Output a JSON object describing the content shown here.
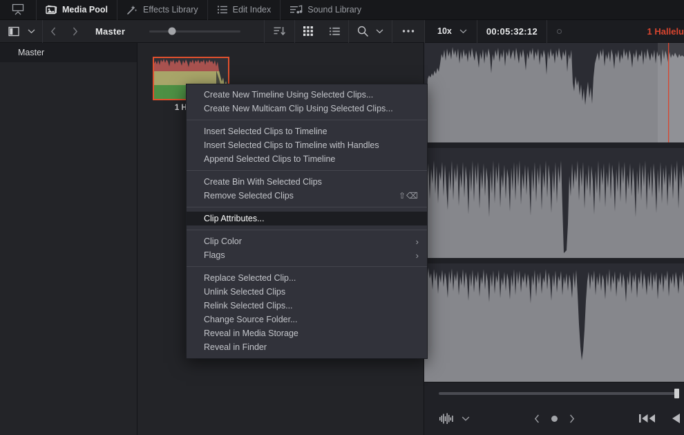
{
  "tabbar": {
    "panel_toggle_icon": "monitor-collapse-icon",
    "tabs": [
      {
        "label": "Media Pool",
        "icon": "media-pool-icon",
        "active": true
      },
      {
        "label": "Effects Library",
        "icon": "effects-wand-icon",
        "active": false
      },
      {
        "label": "Edit Index",
        "icon": "edit-index-list-icon",
        "active": false
      },
      {
        "label": "Sound Library",
        "icon": "sound-library-icon",
        "active": false
      }
    ]
  },
  "toolbar": {
    "sidebar_toggle_icon": "sidebar-panel-icon",
    "sidebar_chevron_icon": "chevron-down-icon",
    "back_icon": "chevron-left-icon",
    "forward_icon": "chevron-right-icon",
    "bin_title": "Master",
    "thumb_size_slider_value": 25,
    "sort_icon": "sort-descending-icon",
    "grid_view_icon": "grid-view-icon",
    "list_view_icon": "list-view-icon",
    "search_icon": "search-icon",
    "search_chevron_icon": "chevron-down-icon",
    "options_icon": "more-options-icon"
  },
  "viewer_toolbar": {
    "zoom_level": "10x",
    "zoom_chevron_icon": "chevron-down-icon",
    "timecode": "00:05:32:12",
    "record_indicator_icon": "record-circle-icon",
    "clip_name": "1 Hallelu"
  },
  "sidebar": {
    "items": [
      {
        "label": "Master",
        "selected": true
      }
    ]
  },
  "media_pool": {
    "clips": [
      {
        "name": "1 Hallelu",
        "selected": true
      }
    ]
  },
  "context_menu": {
    "groups": [
      {
        "items": [
          {
            "label": "Create New Timeline Using Selected Clips...",
            "shortcut": "",
            "submenu": false,
            "highlight": false
          },
          {
            "label": "Create New Multicam Clip Using Selected Clips...",
            "shortcut": "",
            "submenu": false,
            "highlight": false
          }
        ]
      },
      {
        "items": [
          {
            "label": "Insert Selected Clips to Timeline",
            "shortcut": "",
            "submenu": false,
            "highlight": false
          },
          {
            "label": "Insert Selected Clips to Timeline with Handles",
            "shortcut": "",
            "submenu": false,
            "highlight": false
          },
          {
            "label": "Append Selected Clips to Timeline",
            "shortcut": "",
            "submenu": false,
            "highlight": false
          }
        ]
      },
      {
        "items": [
          {
            "label": "Create Bin With Selected Clips",
            "shortcut": "",
            "submenu": false,
            "highlight": false
          },
          {
            "label": "Remove Selected Clips",
            "shortcut": "⇧⌫",
            "submenu": false,
            "highlight": false
          }
        ]
      },
      {
        "items": [
          {
            "label": "Clip Attributes...",
            "shortcut": "",
            "submenu": false,
            "highlight": true
          }
        ]
      },
      {
        "items": [
          {
            "label": "Clip Color",
            "shortcut": "",
            "submenu": true,
            "highlight": false
          },
          {
            "label": "Flags",
            "shortcut": "",
            "submenu": true,
            "highlight": false
          }
        ]
      },
      {
        "items": [
          {
            "label": "Replace Selected Clip...",
            "shortcut": "",
            "submenu": false,
            "highlight": false
          },
          {
            "label": "Unlink Selected Clips",
            "shortcut": "",
            "submenu": false,
            "highlight": false
          },
          {
            "label": "Relink Selected Clips...",
            "shortcut": "",
            "submenu": false,
            "highlight": false
          },
          {
            "label": "Change Source Folder...",
            "shortcut": "",
            "submenu": false,
            "highlight": false
          },
          {
            "label": "Reveal in Media Storage",
            "shortcut": "",
            "submenu": false,
            "highlight": false
          },
          {
            "label": "Reveal in Finder",
            "shortcut": "",
            "submenu": false,
            "highlight": false
          }
        ]
      }
    ]
  },
  "audio_panel": {
    "waveform_view_icon": "audio-waveform-icon",
    "waveform_chevron_icon": "chevron-down-icon",
    "prev_icon": "chevron-left-icon",
    "marker_dot_icon": "dot-icon",
    "next_icon": "chevron-right-icon",
    "skip_start_icon": "skip-to-start-icon",
    "play_reverse_icon": "play-reverse-icon",
    "scrollbar_name": "horizontal-scrollbar"
  },
  "colors": {
    "accent_red": "#d9452f",
    "selection_red": "#e2502d",
    "menu_bg": "#31323a",
    "panel_bg": "#232428",
    "waveform": "#86878c"
  }
}
